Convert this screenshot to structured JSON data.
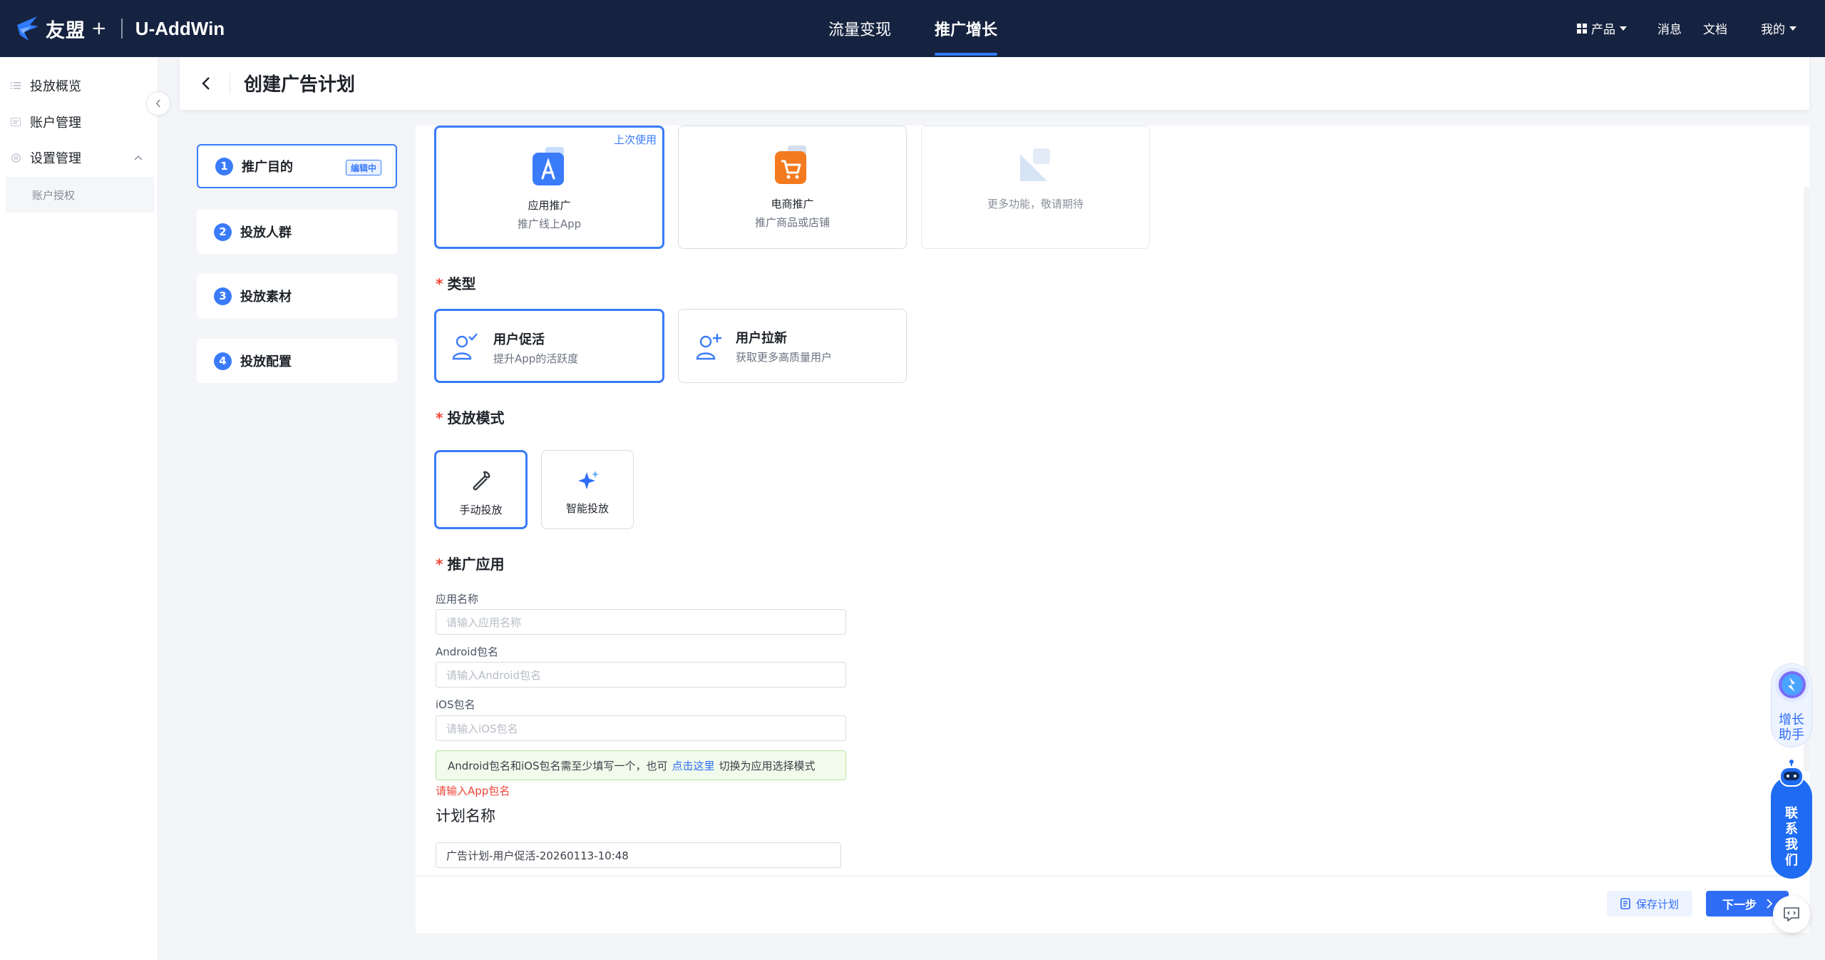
{
  "topbar": {
    "brand": "友盟",
    "brand_plus": "+",
    "product": "U-AddWin",
    "nav": [
      {
        "label": "流量变现",
        "active": false
      },
      {
        "label": "推广增长",
        "active": true
      }
    ],
    "right": {
      "products": "产品",
      "messages": "消息",
      "docs": "文档",
      "mine": "我的"
    }
  },
  "sidebar": {
    "items": [
      {
        "label": "投放概览",
        "icon": "list-icon"
      },
      {
        "label": "账户管理",
        "icon": "card-icon"
      },
      {
        "label": "设置管理",
        "icon": "gear-icon"
      }
    ],
    "sub_items": [
      "账户授权"
    ]
  },
  "header": {
    "title": "创建广告计划"
  },
  "steps": [
    {
      "num": "1",
      "label": "推广目的",
      "badge": "编辑中",
      "active": true
    },
    {
      "num": "2",
      "label": "投放人群",
      "active": false
    },
    {
      "num": "3",
      "label": "投放素材",
      "active": false
    },
    {
      "num": "4",
      "label": "投放配置",
      "active": false
    }
  ],
  "purpose_cards": [
    {
      "title": "应用推广",
      "desc": "推广线上App",
      "tag": "上次使用",
      "selected": true,
      "icon": "app-store-icon"
    },
    {
      "title": "电商推广",
      "desc": "推广商品或店铺",
      "selected": false,
      "icon": "shopping-cart-icon"
    },
    {
      "title": "",
      "desc": "更多功能，敬请期待",
      "selected": false,
      "disabled": true,
      "icon": "placeholder-icon"
    }
  ],
  "type_section": {
    "title": "类型",
    "options": [
      {
        "title": "用户促活",
        "desc": "提升App的活跃度",
        "selected": true,
        "icon": "user-check-icon"
      },
      {
        "title": "用户拉新",
        "desc": "获取更多高质量用户",
        "selected": false,
        "icon": "user-add-icon"
      }
    ]
  },
  "mode_section": {
    "title": "投放模式",
    "options": [
      {
        "label": "手动投放",
        "selected": true,
        "icon": "wrench-icon"
      },
      {
        "label": "智能投放",
        "selected": false,
        "icon": "sparkle-icon"
      }
    ]
  },
  "app_section": {
    "title": "推广应用",
    "fields": [
      {
        "label": "应用名称",
        "placeholder": "请输入应用名称"
      },
      {
        "label": "Android包名",
        "placeholder": "请输入Android包名"
      },
      {
        "label": "iOS包名",
        "placeholder": "请输入iOS包名"
      }
    ],
    "notice": {
      "before": "Android包名和iOS包名需至少填写一个，也可",
      "link": "点击这里",
      "after": "切换为应用选择模式"
    },
    "error": "请输入App包名"
  },
  "plan_section": {
    "title": "计划名称",
    "value": "广告计划-用户促活-20260113-10:48"
  },
  "footer": {
    "save": "保存计划",
    "next": "下一步"
  },
  "floating": {
    "growth_assistant": "增长助手",
    "contact_us": "联系我们"
  },
  "colors": {
    "topbar": "#162340",
    "primary": "#3a7bfa",
    "error": "#f04438"
  }
}
